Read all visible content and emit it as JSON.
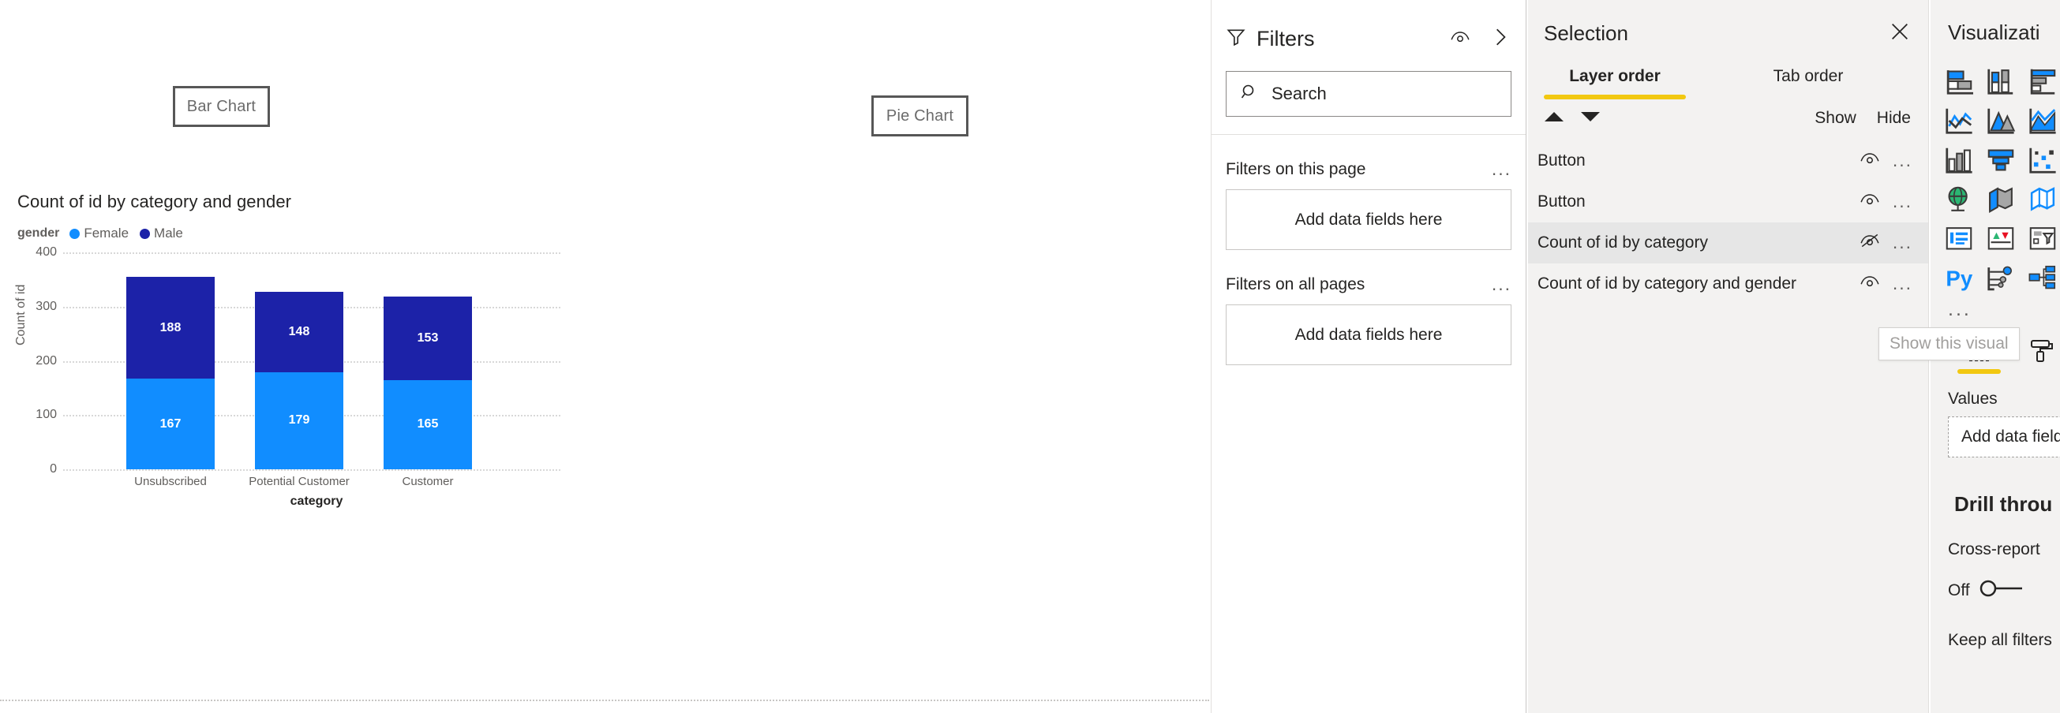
{
  "canvas": {
    "buttons": [
      {
        "label": "Bar Chart",
        "name": "bar-chart-nav-button"
      },
      {
        "label": "Pie Chart",
        "name": "pie-chart-nav-button"
      }
    ]
  },
  "chart_data": {
    "type": "bar",
    "subtype": "stacked-column",
    "title": "Count of id by category and gender",
    "xlabel": "category",
    "ylabel": "Count of id",
    "legend_title": "gender",
    "legend_position": "top",
    "grid": true,
    "ylim": [
      0,
      400
    ],
    "yticks": [
      0,
      100,
      200,
      300,
      400
    ],
    "categories": [
      "Unsubscribed",
      "Potential Customer",
      "Customer"
    ],
    "series": [
      {
        "name": "Female",
        "color": "#118DFF",
        "values": [
          167,
          179,
          165
        ]
      },
      {
        "name": "Male",
        "color": "#1C22A8",
        "values": [
          188,
          148,
          153
        ]
      }
    ]
  },
  "filters": {
    "title": "Filters",
    "filter_icon": "funnel-icon",
    "eye_icon": "eye-icon",
    "expand_icon": "chevron-right-icon",
    "search": {
      "placeholder": "Search",
      "value": "",
      "icon": "search-icon"
    },
    "sections": [
      {
        "title": "Filters on this page",
        "dropzone": "Add data fields here",
        "menu": "..."
      },
      {
        "title": "Filters on all pages",
        "dropzone": "Add data fields here",
        "menu": "..."
      }
    ]
  },
  "selection": {
    "title": "Selection",
    "close_icon": "close-icon",
    "tabs": [
      {
        "label": "Layer order",
        "active": true
      },
      {
        "label": "Tab order",
        "active": false
      }
    ],
    "accent_color": "#F2C811",
    "move_up_icon": "triangle-up-icon",
    "move_down_icon": "triangle-down-icon",
    "show_label": "Show",
    "hide_label": "Hide",
    "items": [
      {
        "label": "Button",
        "visible": true,
        "selected": false,
        "menu": "..."
      },
      {
        "label": "Button",
        "visible": true,
        "selected": false,
        "menu": "..."
      },
      {
        "label": "Count of id by category",
        "visible": false,
        "selected": true,
        "menu": "..."
      },
      {
        "label": "Count of id by category and gender",
        "visible": true,
        "selected": false,
        "menu": "..."
      }
    ],
    "tooltip": "Show this visual"
  },
  "visualizations": {
    "title": "Visualizati",
    "more_icon": "...",
    "icons": [
      "stacked-bar-chart-icon",
      "stacked-column-chart-icon",
      "clustered-bar-chart-icon",
      "line-chart-icon",
      "area-chart-icon",
      "stacked-area-chart-icon",
      "line-and-column-chart-icon",
      "funnel-chart-icon",
      "scatter-chart-icon",
      "globe-map-icon",
      "filled-map-icon",
      "shape-map-icon",
      "table-icon",
      "kpi-icon",
      "slicer-icon",
      "python-visual-icon",
      "decomposition-tree-icon",
      "hierarchy-icon"
    ],
    "tabs": [
      {
        "name": "fields-tab-icon",
        "active": true
      },
      {
        "name": "format-paint-roller-icon",
        "active": false
      }
    ],
    "values_label": "Values",
    "values_dropzone": "Add data field",
    "drill_title": "Drill throu",
    "cross_report_label": "Cross-report",
    "toggle_state": "Off",
    "keep_filters_label": "Keep all filters"
  }
}
